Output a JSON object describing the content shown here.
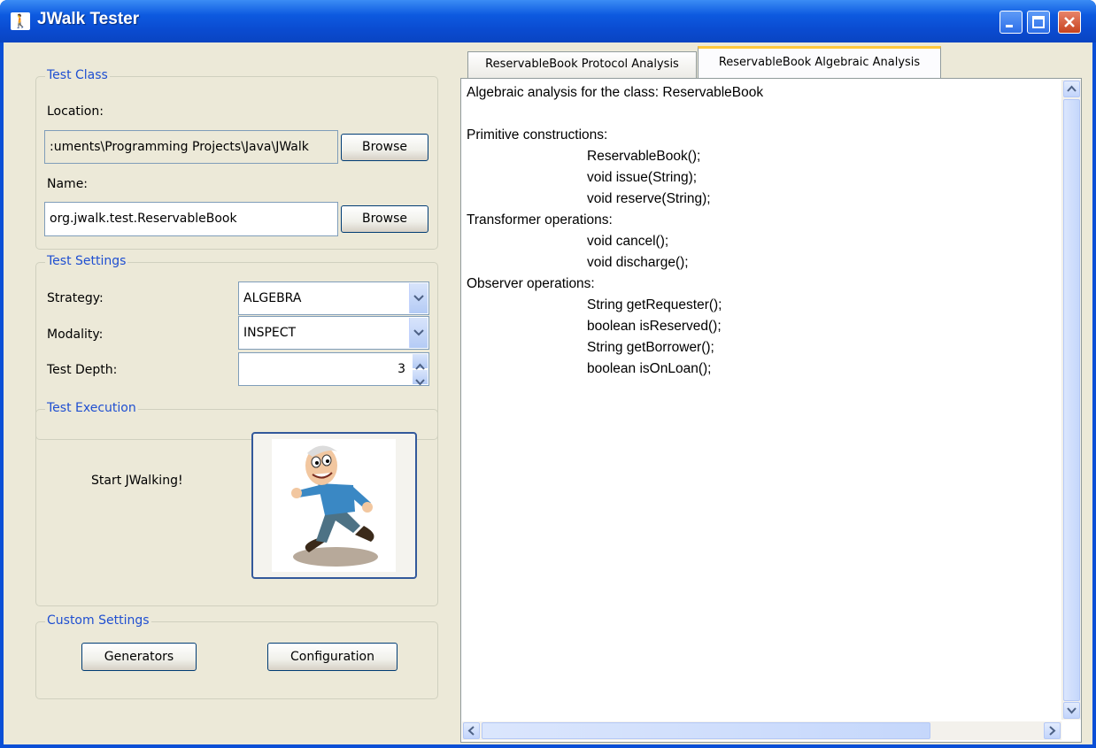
{
  "window": {
    "title": "JWalk Tester",
    "icon": "jwalk-app-icon"
  },
  "test_class": {
    "legend": "Test Class",
    "location_label": "Location:",
    "location_value": ":uments\\Programming Projects\\Java\\JWalk",
    "location_browse": "Browse",
    "name_label": "Name:",
    "name_value": "org.jwalk.test.ReservableBook",
    "name_browse": "Browse"
  },
  "test_settings": {
    "legend": "Test Settings",
    "strategy_label": "Strategy:",
    "strategy_value": "ALGEBRA",
    "modality_label": "Modality:",
    "modality_value": "INSPECT",
    "depth_label": "Test Depth:",
    "depth_value": "3"
  },
  "test_execution": {
    "legend": "Test Execution",
    "start_label": "Start JWalking!",
    "walker_icon": "walking-man-icon"
  },
  "custom_settings": {
    "legend": "Custom Settings",
    "generators_button": "Generators",
    "configuration_button": "Configuration"
  },
  "tabs": [
    {
      "label": "ReservableBook Protocol Analysis",
      "active": false
    },
    {
      "label": "ReservableBook Algebraic Analysis",
      "active": true
    }
  ],
  "analysis": {
    "heading": "Algebraic analysis for the class: ReservableBook",
    "lines": [
      {
        "text": "Primitive constructions:",
        "indent": false
      },
      {
        "text": "ReservableBook();",
        "indent": true
      },
      {
        "text": "void issue(String);",
        "indent": true
      },
      {
        "text": "void reserve(String);",
        "indent": true
      },
      {
        "text": "Transformer operations:",
        "indent": false
      },
      {
        "text": "void cancel();",
        "indent": true
      },
      {
        "text": "void discharge();",
        "indent": true
      },
      {
        "text": "Observer operations:",
        "indent": false
      },
      {
        "text": "String getRequester();",
        "indent": true
      },
      {
        "text": "boolean isReserved();",
        "indent": true
      },
      {
        "text": "String getBorrower();",
        "indent": true
      },
      {
        "text": "boolean isOnLoan();",
        "indent": true
      }
    ]
  },
  "colors": {
    "titlebar": "#0a4fd6",
    "legend_text": "#1f4fd1",
    "dialog_bg": "#ece9d8",
    "active_tab_accent": "#ffc83c"
  }
}
